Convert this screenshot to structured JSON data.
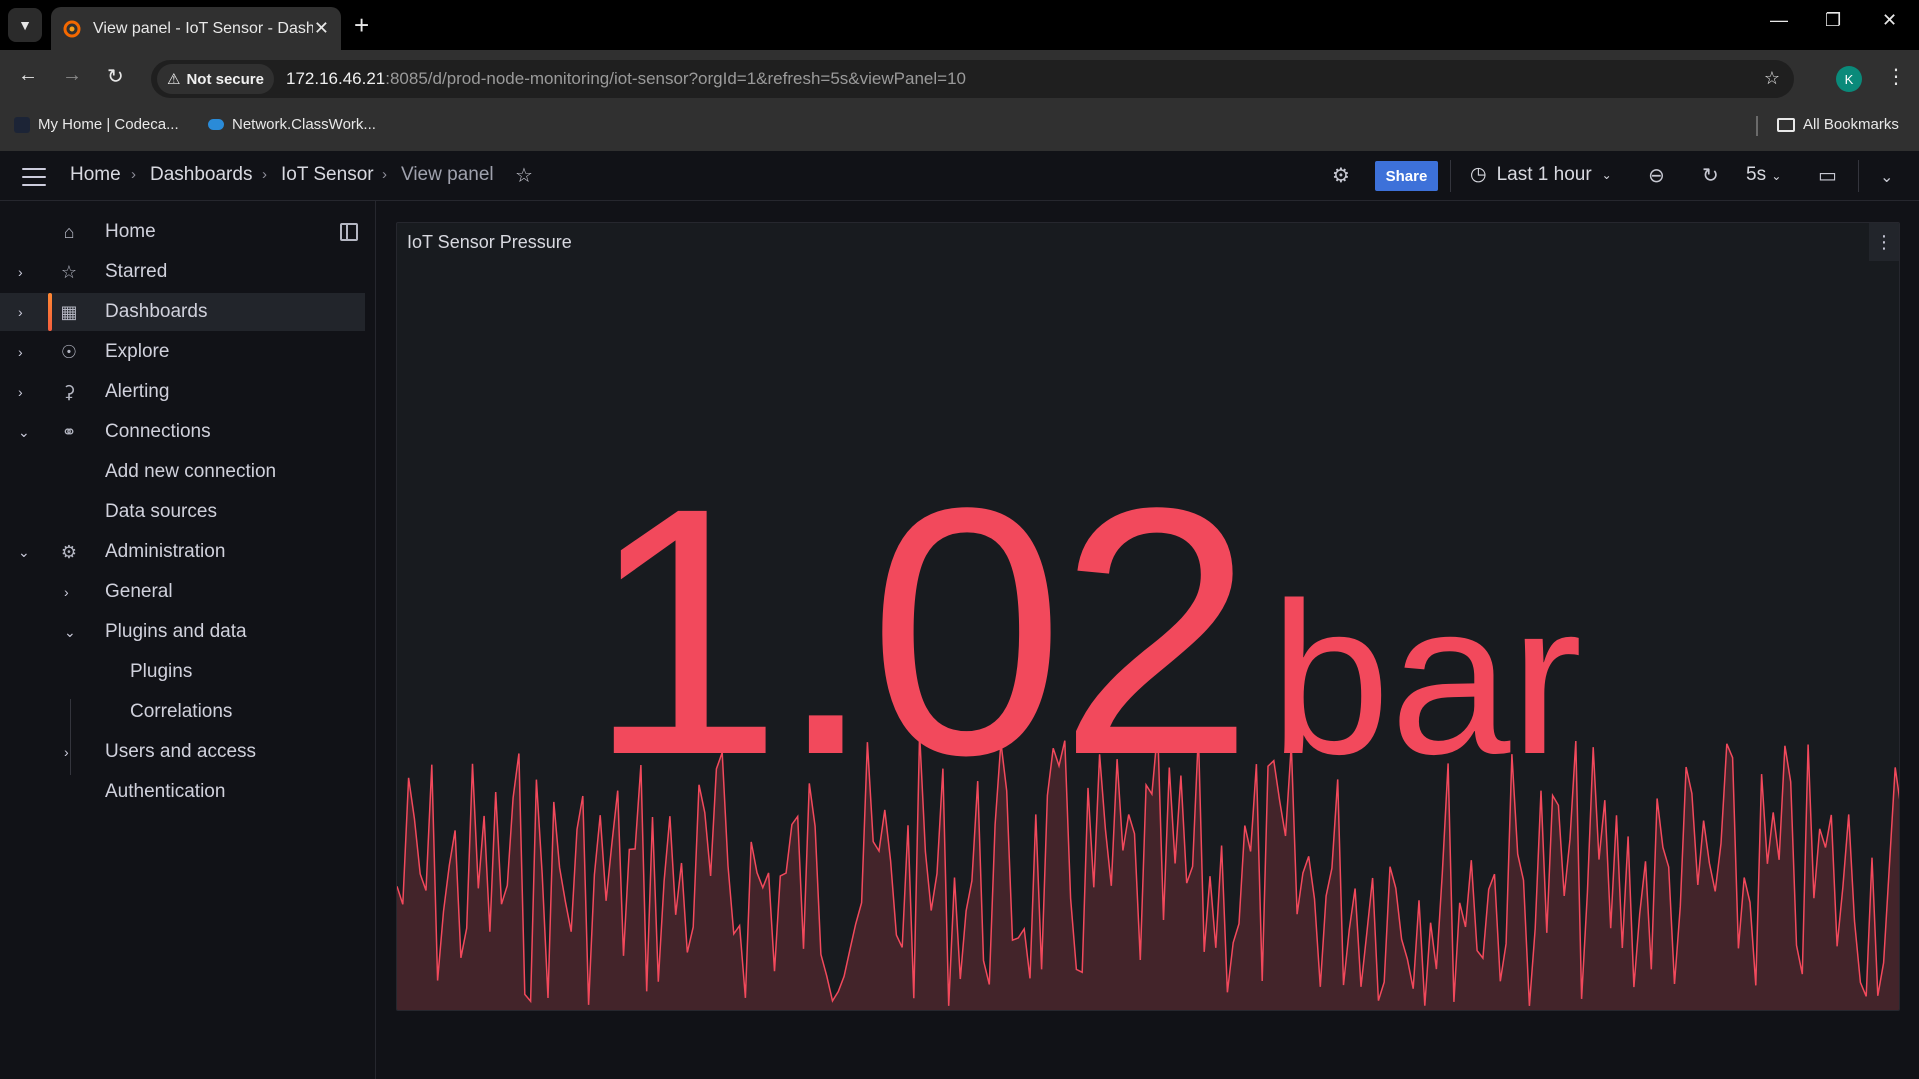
{
  "browser": {
    "tab_title": "View panel - IoT Sensor - Dashb",
    "security_label": "Not secure",
    "url_host": "172.16.46.21",
    "url_rest": ":8085/d/prod-node-monitoring/iot-sensor?orgId=1&refresh=5s&viewPanel=10",
    "profile_initial": "K",
    "bookmarks": [
      {
        "label": "My Home | Codeca..."
      },
      {
        "label": "Network.ClassWork..."
      }
    ],
    "all_bookmarks_label": "All Bookmarks"
  },
  "topnav": {
    "breadcrumbs": [
      "Home",
      "Dashboards",
      "IoT Sensor",
      "View panel"
    ],
    "share_label": "Share",
    "time_range": "Last 1 hour",
    "refresh_interval": "5s"
  },
  "sidebar": {
    "items": [
      {
        "label": "Home",
        "icon": "home-icon"
      },
      {
        "label": "Starred",
        "icon": "star-icon"
      },
      {
        "label": "Dashboards",
        "icon": "apps-icon"
      },
      {
        "label": "Explore",
        "icon": "compass-icon"
      },
      {
        "label": "Alerting",
        "icon": "bell-icon"
      },
      {
        "label": "Connections",
        "icon": "link-icon"
      },
      {
        "label": "Add new connection"
      },
      {
        "label": "Data sources"
      },
      {
        "label": "Administration",
        "icon": "cog-icon"
      },
      {
        "label": "General"
      },
      {
        "label": "Plugins and data"
      },
      {
        "label": "Plugins"
      },
      {
        "label": "Correlations"
      },
      {
        "label": "Users and access"
      },
      {
        "label": "Authentication"
      }
    ]
  },
  "panel": {
    "title": "IoT Sensor Pressure",
    "value": "1.02",
    "unit": "bar",
    "color": "#f2495c"
  }
}
